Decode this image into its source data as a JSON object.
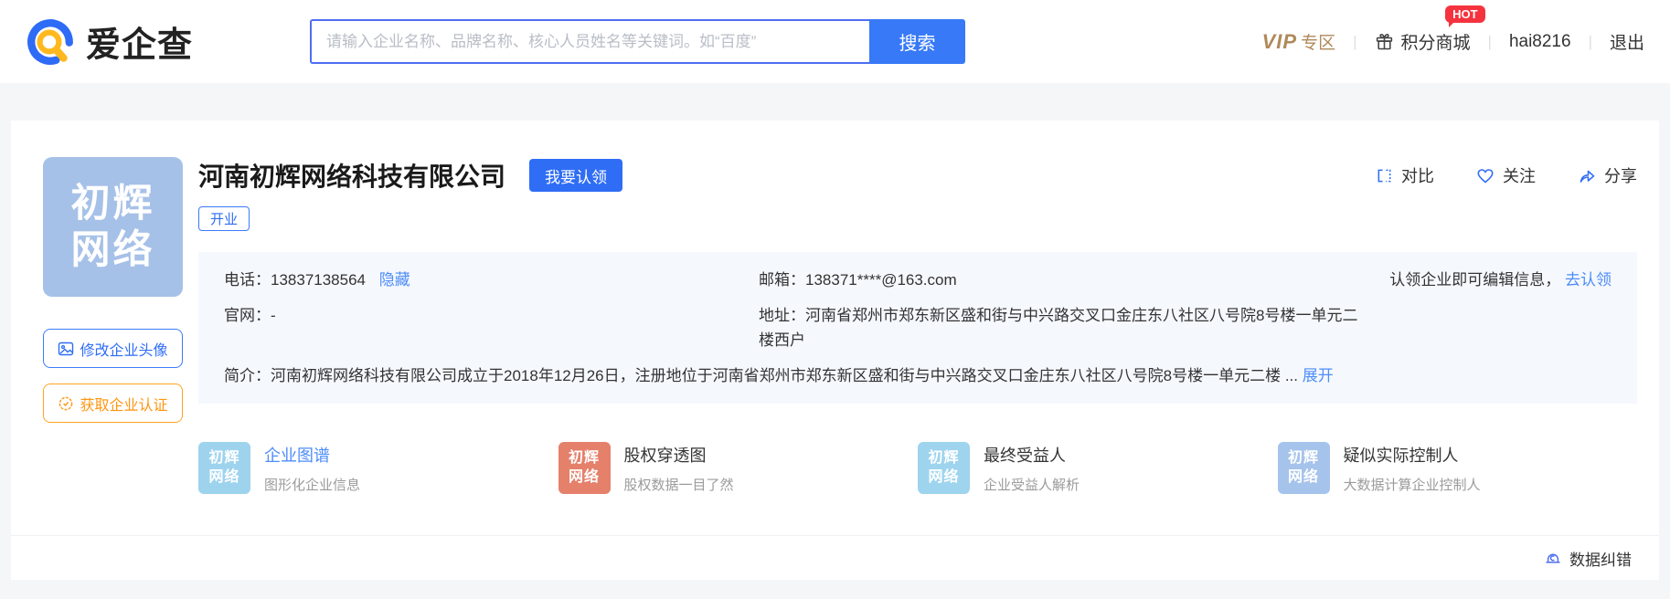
{
  "header": {
    "brand": "爱企查",
    "search": {
      "placeholder": "请输入企业名称、品牌名称、核心人员姓名等关键词。如“百度”",
      "button": "搜索"
    },
    "nav": {
      "vip_word": "VIP",
      "vip_suffix": "专区",
      "points_mall": "积分商城",
      "hot_badge": "HOT",
      "username": "hai8216",
      "logout": "退出"
    }
  },
  "company": {
    "name": "河南初辉网络科技有限公司",
    "claim_button": "我要认领",
    "status_tag": "开业",
    "logo": {
      "line1": "初辉",
      "line2": "网络"
    },
    "actions": {
      "compare": "对比",
      "follow": "关注",
      "share": "分享"
    },
    "avatar_button": "修改企业头像",
    "cert_button": "获取企业认证"
  },
  "info": {
    "phone_label": "电话：",
    "phone": "13837138564",
    "hide_link": "隐藏",
    "email_label": "邮箱：",
    "email": "138371****@163.com",
    "claim_tip": "认领企业即可编辑信息，",
    "claim_link": "去认领",
    "website_label": "官网：",
    "website": "-",
    "address_label": "地址：",
    "address": "河南省郑州市郑东新区盛和街与中兴路交叉口金庄东八社区八号院8号楼一单元二楼西户",
    "intro_label": "简介：",
    "intro": "河南初辉网络科技有限公司成立于2018年12月26日，注册地位于河南省郑州市郑东新区盛和街与中兴路交叉口金庄东八社区八号院8号楼一单元二楼",
    "ellipsis": "...",
    "expand_link": "展开"
  },
  "features": [
    {
      "title": "企业图谱",
      "subtitle": "图形化企业信息",
      "thumb_line1": "初辉",
      "thumb_line2": "网络",
      "color": "#9ed3ee",
      "title_color": "#4e8df9"
    },
    {
      "title": "股权穿透图",
      "subtitle": "股权数据一目了然",
      "thumb_line1": "初辉",
      "thumb_line2": "网络",
      "color": "#e5806b",
      "title_color": "#333333"
    },
    {
      "title": "最终受益人",
      "subtitle": "企业受益人解析",
      "thumb_line1": "初辉",
      "thumb_line2": "网络",
      "color": "#9fd4ee",
      "title_color": "#333333"
    },
    {
      "title": "疑似实际控制人",
      "subtitle": "大数据计算企业控制人",
      "thumb_line1": "初辉",
      "thumb_line2": "网络",
      "color": "#a6c3ec",
      "title_color": "#333333"
    }
  ],
  "footer": {
    "correction": "数据纠错"
  },
  "colors": {
    "primary_blue": "#2f6df5",
    "link_blue": "#4e8df9",
    "gold": "#b0895a",
    "hot_red": "#f5333f",
    "orange": "#ff9612"
  }
}
